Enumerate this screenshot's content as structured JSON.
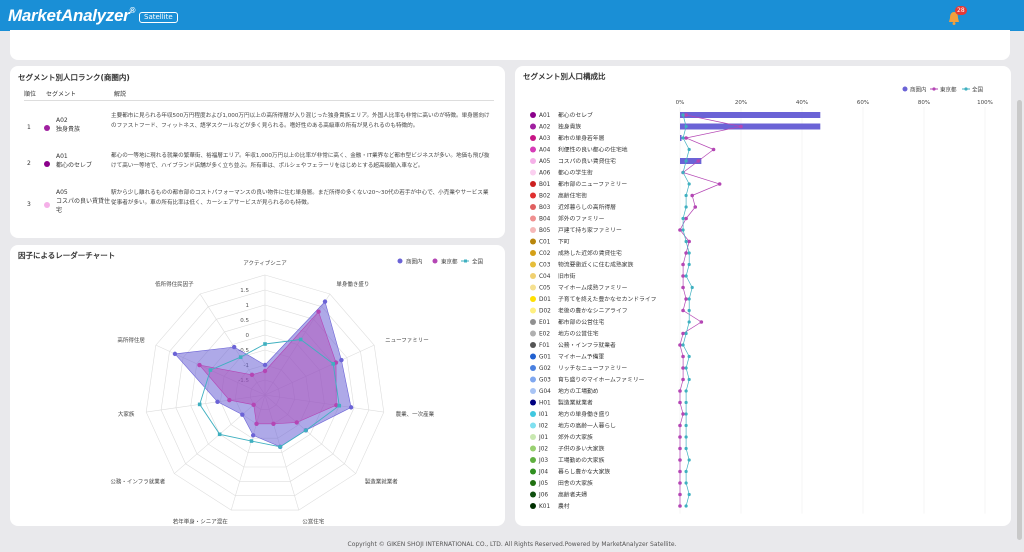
{
  "app": {
    "name": "MarketAnalyzer",
    "reg": "®",
    "badge": "Satellite",
    "notifications": "28"
  },
  "ranking": {
    "title": "セグメント別人口ランク(商圏内)",
    "columns": [
      "順位",
      "セグメント",
      "解説"
    ],
    "rows": [
      {
        "rank": "1",
        "code": "A02",
        "name": "独身貴族",
        "color": "#a020a0",
        "desc": "主要都市に見られる年収500万円程度および1,000万円以上の高所得層が入り混じった独身貴族エリア。外国人比率も非常に高いのが特徴。単身層向けのファストフード、フィットネス、語学スクールなどが多く見られる。嗜好性のある高級車の所有が見られるのも特徴的。"
      },
      {
        "rank": "2",
        "code": "A01",
        "name": "都心のセレブ",
        "color": "#8b008b",
        "desc": "都心の一等地に現れる就業の繁華街、裕福層エリア。年収1,000万円以上の比率が非常に高く、金融・IT業界など都市型ビジネスが多い。地価も飛び抜けて高い一等地で、ハイブランド店舗が多く立ち並ぶ。所有車は、ポルシェやフェラーリをはじめとする超高級輸入車など。"
      },
      {
        "rank": "3",
        "code": "A05",
        "name": "コスパの良い賃貸住宅",
        "color": "#f5b0e8",
        "desc": "駅から少し離れるものの都市部のコストパフォーマンスの良い物件に住む単身層。まだ所得の多くない20〜30代の若手が中心で、小売業やサービス業従事者が多い。車の所有比率は低く、カーシェアサービスが見られるのも特徴。"
      }
    ]
  },
  "radar": {
    "title": "因子によるレーダーチャート",
    "legend": [
      "商圏内",
      "東京都",
      "全国"
    ],
    "axes": [
      "アクティブシニア",
      "単身働き盛り",
      "ニューファミリー",
      "農業、一次産業",
      "製造業就業者",
      "公営住宅",
      "若年単身・シニア混在",
      "公務・インフラ就業者",
      "大家族",
      "高所得住居",
      "低所得住民因子"
    ],
    "ticks": [
      "-1.5",
      "-1",
      "-0.5",
      "0",
      "0.5",
      "1",
      "1.5"
    ],
    "range": [
      -2,
      2
    ],
    "series": [
      {
        "name": "商圏内",
        "color": "#6b63d6",
        "values": [
          -1.0,
          1.7,
          0.8,
          0.9,
          -0.2,
          -0.2,
          -0.6,
          -1.0,
          -0.4,
          1.3,
          -0.1
        ]
      },
      {
        "name": "東京都",
        "color": "#b446b4",
        "values": [
          -1.2,
          1.3,
          0.6,
          0.4,
          -0.6,
          -1.0,
          -1.0,
          -1.5,
          -0.8,
          0.4,
          -1.2
        ]
      },
      {
        "name": "全国",
        "color": "#3fb0c0",
        "values": [
          -0.3,
          0.2,
          0.5,
          0.5,
          -0.2,
          -0.2,
          -0.4,
          0.0,
          0.2,
          0.0,
          -0.5
        ]
      }
    ]
  },
  "segments": {
    "title": "セグメント別人口構成比",
    "legend": [
      "商圏内",
      "東京都",
      "全国"
    ],
    "axis_ticks": [
      "0%",
      "20%",
      "40%",
      "60%",
      "80%",
      "100%"
    ],
    "colors": {
      "area": "#6b63d6",
      "tokyo": "#b446b4",
      "national": "#3fb0c0"
    },
    "items": [
      {
        "code": "A01",
        "name": "都心のセレブ",
        "color": "#8b008b",
        "area": 46,
        "tokyo": 2,
        "national": 1
      },
      {
        "code": "A02",
        "name": "独身貴族",
        "color": "#a020a0",
        "area": 46,
        "tokyo": 20,
        "national": 2
      },
      {
        "code": "A03",
        "name": "都市の単身若年層",
        "color": "#c71585",
        "area": 0.5,
        "tokyo": 2,
        "national": 1
      },
      {
        "code": "A04",
        "name": "利便性の良い都心の住宅地",
        "color": "#d63cb8",
        "area": 0,
        "tokyo": 11,
        "national": 3
      },
      {
        "code": "A05",
        "name": "コスパの良い賃貸住宅",
        "color": "#f5b0e8",
        "area": 7,
        "tokyo": 6,
        "national": 2
      },
      {
        "code": "A06",
        "name": "都心の学生街",
        "color": "#fbd0f0",
        "area": 0,
        "tokyo": 1,
        "national": 1
      },
      {
        "code": "B01",
        "name": "都市部のニューファミリー",
        "color": "#cc2020",
        "area": 0,
        "tokyo": 13,
        "national": 3
      },
      {
        "code": "B02",
        "name": "高齢住宅街",
        "color": "#e03030",
        "area": 0,
        "tokyo": 4,
        "national": 2
      },
      {
        "code": "B03",
        "name": "近郊暮らしの高所得層",
        "color": "#e06060",
        "area": 0,
        "tokyo": 5,
        "national": 2
      },
      {
        "code": "B04",
        "name": "郊外のファミリー",
        "color": "#f09090",
        "area": 0,
        "tokyo": 2,
        "national": 1
      },
      {
        "code": "B05",
        "name": "戸建て持ち家ファミリー",
        "color": "#f5b8b8",
        "area": 0,
        "tokyo": 0,
        "national": 1
      },
      {
        "code": "C01",
        "name": "下町",
        "color": "#b8860b",
        "area": 0,
        "tokyo": 3,
        "national": 2
      },
      {
        "code": "C02",
        "name": "成熟した近郊の賃貸住宅",
        "color": "#d4a017",
        "area": 0,
        "tokyo": 2,
        "national": 3
      },
      {
        "code": "C03",
        "name": "物流要衝近くに住む成熟家族",
        "color": "#e6be3a",
        "area": 0,
        "tokyo": 1,
        "national": 3
      },
      {
        "code": "C04",
        "name": "旧市街",
        "color": "#f0d070",
        "area": 0,
        "tokyo": 1,
        "national": 2
      },
      {
        "code": "C05",
        "name": "マイホーム成熟ファミリー",
        "color": "#f5e090",
        "area": 0,
        "tokyo": 1,
        "national": 4
      },
      {
        "code": "D01",
        "name": "子育てを終えた豊かなセカンドライフ",
        "color": "#ffe000",
        "area": 0,
        "tokyo": 2,
        "national": 3
      },
      {
        "code": "D02",
        "name": "老後の豊かなシニアライフ",
        "color": "#fff080",
        "area": 0,
        "tokyo": 1,
        "national": 3
      },
      {
        "code": "E01",
        "name": "都市部の公営住宅",
        "color": "#909090",
        "area": 0,
        "tokyo": 7,
        "national": 3
      },
      {
        "code": "E02",
        "name": "地方の公営住宅",
        "color": "#b0b0b0",
        "area": 0,
        "tokyo": 1,
        "national": 2
      },
      {
        "code": "F01",
        "name": "公務・インフラ就業者",
        "color": "#555555",
        "area": 0,
        "tokyo": 0,
        "national": 1
      },
      {
        "code": "G01",
        "name": "マイホーム予備軍",
        "color": "#2060d0",
        "area": 0,
        "tokyo": 1,
        "national": 3
      },
      {
        "code": "G02",
        "name": "リッチなニューファミリー",
        "color": "#4a80e0",
        "area": 0,
        "tokyo": 1,
        "national": 2
      },
      {
        "code": "G03",
        "name": "育ち盛りのマイホームファミリー",
        "color": "#80a8f0",
        "area": 0,
        "tokyo": 1,
        "national": 3
      },
      {
        "code": "G04",
        "name": "地方の工場勤め",
        "color": "#a8c4f5",
        "area": 0,
        "tokyo": 0,
        "national": 2
      },
      {
        "code": "H01",
        "name": "製造業就業者",
        "color": "#000080",
        "area": 0,
        "tokyo": 0,
        "national": 2
      },
      {
        "code": "I01",
        "name": "地方の単身働き盛り",
        "color": "#40c8e0",
        "area": 0,
        "tokyo": 1,
        "national": 2
      },
      {
        "code": "I02",
        "name": "地方の高齢一人暮らし",
        "color": "#80e0f0",
        "area": 0,
        "tokyo": 0,
        "national": 2
      },
      {
        "code": "J01",
        "name": "郊外の大家族",
        "color": "#c8e8b0",
        "area": 0,
        "tokyo": 0,
        "national": 2
      },
      {
        "code": "J02",
        "name": "子供の多い大家族",
        "color": "#98d070",
        "area": 0,
        "tokyo": 0,
        "national": 2
      },
      {
        "code": "J03",
        "name": "工場勤めの大家族",
        "color": "#60b040",
        "area": 0,
        "tokyo": 0,
        "national": 3
      },
      {
        "code": "J04",
        "name": "暮らし豊かな大家族",
        "color": "#309020",
        "area": 0,
        "tokyo": 0,
        "national": 2
      },
      {
        "code": "J05",
        "name": "田舎の大家族",
        "color": "#207010",
        "area": 0,
        "tokyo": 0,
        "national": 2
      },
      {
        "code": "J06",
        "name": "高齢者夫婦",
        "color": "#105010",
        "area": 0,
        "tokyo": 0,
        "national": 3
      },
      {
        "code": "K01",
        "name": "農村",
        "color": "#003000",
        "area": 0,
        "tokyo": 0,
        "national": 2
      }
    ]
  },
  "footer": "Copyright © GIKEN SHOJI INTERNATIONAL CO., LTD. All Rights Reserved.Powered by MarketAnalyzer Satellite."
}
